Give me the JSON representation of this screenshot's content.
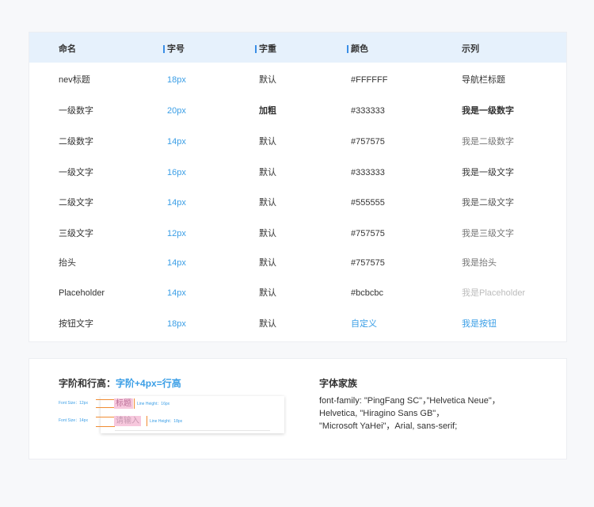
{
  "table": {
    "headers": [
      "命名",
      "字号",
      "字重",
      "颜色",
      "示列"
    ],
    "rows": [
      {
        "name": "nev标题",
        "size": "18px",
        "weight": "默认",
        "color": "#FFFFFF",
        "example": "导航栏标题",
        "example_color": "#333333",
        "example_bold": false,
        "color_is_link": false
      },
      {
        "name": "一级数字",
        "size": "20px",
        "weight": "加粗",
        "color": "#333333",
        "example": "我是一级数字",
        "example_color": "#333333",
        "example_bold": true,
        "color_is_link": false
      },
      {
        "name": "二级数字",
        "size": "14px",
        "weight": "默认",
        "color": "#757575",
        "example": "我是二级数字",
        "example_color": "#757575",
        "example_bold": false,
        "color_is_link": false
      },
      {
        "name": "一级文字",
        "size": "16px",
        "weight": "默认",
        "color": "#333333",
        "example": "我是一级文字",
        "example_color": "#333333",
        "example_bold": false,
        "color_is_link": false
      },
      {
        "name": "二级文字",
        "size": "14px",
        "weight": "默认",
        "color": "#555555",
        "example": "我是二级文字",
        "example_color": "#555555",
        "example_bold": false,
        "color_is_link": false
      },
      {
        "name": "三级文字",
        "size": "12px",
        "weight": "默认",
        "color": "#757575",
        "example": "我是三级文字",
        "example_color": "#757575",
        "example_bold": false,
        "color_is_link": false
      },
      {
        "name": "抬头",
        "size": "14px",
        "weight": "默认",
        "color": "#757575",
        "example": "我是抬头",
        "example_color": "#757575",
        "example_bold": false,
        "color_is_link": false
      },
      {
        "name": "Placeholder",
        "size": "14px",
        "weight": "默认",
        "color": "#bcbcbc",
        "example": "我是Placeholder",
        "example_color": "#bcbcbc",
        "example_bold": false,
        "color_is_link": false
      },
      {
        "name": "按钮文字",
        "size": "18px",
        "weight": "默认",
        "color": "自定义",
        "example": "我是按钮",
        "example_color": "#3a9ee6",
        "example_bold": false,
        "color_is_link": true
      }
    ]
  },
  "line_height": {
    "title_prefix": "字阶和行高：",
    "title_formula": "字阶+4px=行高",
    "demo": {
      "font_size_1": "Font Size：12px",
      "sample_1": "标题",
      "line_height_1": "Line Height：16px",
      "font_size_2": "Font Size：14px",
      "sample_2": "请输入",
      "line_height_2": "Line Height：18px"
    }
  },
  "font_family": {
    "title": "字体家族",
    "lines": [
      "font-family: \"PingFang SC\"，”Helvetica Neue\"，",
      " Helvetica, \"Hiragino Sans GB\"，",
      "\"Microsoft YaHei\"，Arial, sans-serif;"
    ]
  },
  "colors": {
    "accent": "#3a9ee6",
    "header_bg": "#e6f1fc",
    "page_bg": "#f7f8fa"
  }
}
